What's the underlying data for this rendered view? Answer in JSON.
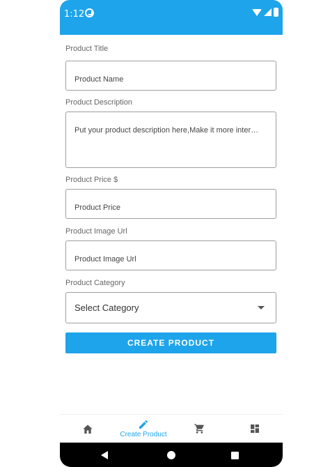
{
  "status_bar": {
    "time": "1:12"
  },
  "form": {
    "title_label": "Product Title",
    "title_placeholder": "Product Name",
    "description_label": "Product Description",
    "description_placeholder": "Put your product description here,Make it more inter…",
    "price_label": "Product Price $",
    "price_placeholder": "Product Price",
    "image_label": "Product Image Url",
    "image_placeholder": "Product Image Url",
    "category_label": "Product Category",
    "category_selected": "Select Category",
    "submit_label": "CREATE PRODUCT"
  },
  "bottom_nav": {
    "items": [
      {
        "icon": "home-icon",
        "label": ""
      },
      {
        "icon": "pencil-icon",
        "label": "Create Product",
        "active": true
      },
      {
        "icon": "cart-icon",
        "label": ""
      },
      {
        "icon": "dashboard-icon",
        "label": ""
      }
    ]
  },
  "colors": {
    "primary": "#1ea4ea",
    "inactive_icon": "#555555"
  }
}
